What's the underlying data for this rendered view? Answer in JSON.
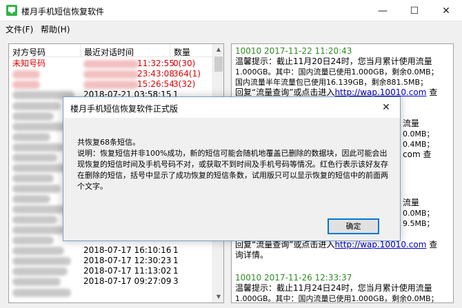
{
  "window": {
    "title": "楼月手机短信恢复软件",
    "min": "—",
    "max": "☐",
    "close": "✕"
  },
  "menu": {
    "file": "文件(F)",
    "help": "帮助(H)"
  },
  "list": {
    "headers": {
      "number": "对方号码",
      "time": "最近对话时间",
      "count": "数量"
    },
    "rows": [
      {
        "number": "未知号码",
        "time": "11:32:55",
        "count": "0(30)",
        "red": true
      },
      {
        "number": "",
        "time": "23:43:08",
        "count": "364(1)",
        "red": true
      },
      {
        "number": "",
        "time": "15:26:54",
        "count": "3(32)",
        "red": true
      },
      {
        "number": "",
        "time": "2018-07-21 03:58:15",
        "count": "1",
        "red": false
      },
      {
        "number": "",
        "time": "2018-07-17 16:10:16",
        "count": "1",
        "red": false
      },
      {
        "number": "",
        "time": "2018-07-17 12:30:23",
        "count": "1",
        "red": false
      },
      {
        "number": "",
        "time": "2018-07-17 11:13:02",
        "count": "1",
        "red": false
      },
      {
        "number": "",
        "time": "2018-07-17 09:27:09",
        "count": "3",
        "red": false
      }
    ]
  },
  "messages": {
    "m1_header": "10010 2017-11-22 11:20:43",
    "m1_l1": "温馨提示：截止11月20日24时，您当月累计使用流量",
    "m1_l2": "1.000GB。其中：国内流量已使用1.000GB，剩余0.0MB；",
    "m1_l3": "国内流量半年流量包已使用16.139GB，剩余881.5MB；",
    "m1_l4a": "回复“流量查询”或点击进入",
    "m1_l4b": "http://wap.10010.com",
    "m1_l4c": " 查",
    "mid_l1": "流量",
    "mid_l2": "0.0MB；",
    "mid_l3": "0.4MB；",
    "mid_l4": "com 查",
    "mid_l5": "流量",
    "mid_l6": "0.0MB；",
    "mid_l7": "9.5MB；",
    "m2_tail_a": "回复“流量查询”或点击进入",
    "m2_tail_b": "http://wap.10010.com",
    "m2_tail_c": " 查",
    "m2_tail2": "询详情。",
    "m3_header": "10010 2017-11-26 12:33:37",
    "m3_l1": "温馨提示：截止11月24日24时，您当月累计使用流量",
    "m3_l2": "1.000GB。其中：国内流量已使用1.000GB，剩余0.0MB；"
  },
  "dialog": {
    "title": "楼月手机短信恢复软件正式版",
    "close": "✕",
    "line1": "共恢复68条短信。",
    "line2": "说明：恢复短信并非100%成功，新的短信可能会随机地覆盖已删除的数据块，因此可能会出现恢复的短信时间及手机号码不对，或获取不到时间及手机号码等情况。红色行表示该好友存在删除的短信，括号中显示了成功恢复的短信条数，试用版只可以显示恢复的短信中的前面两个文字。",
    "ok": "确定"
  }
}
